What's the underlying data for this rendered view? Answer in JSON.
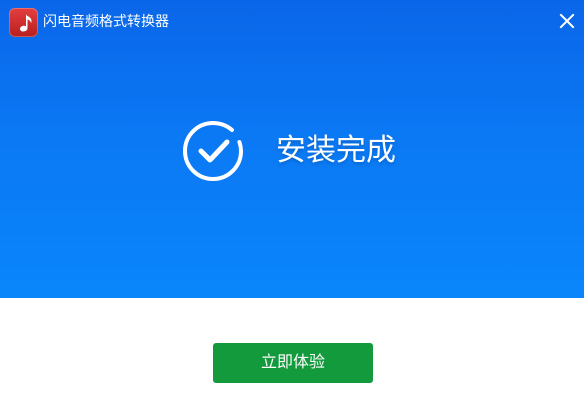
{
  "window": {
    "title": "闪电音频格式转换器",
    "app_icon": "music-note-icon",
    "close_icon": "close-icon"
  },
  "banner": {
    "status_icon": "check-circle-icon",
    "status_text": "安装完成"
  },
  "actions": {
    "primary_button": "立即体验"
  },
  "colors": {
    "banner": "#0a78f4",
    "button": "#139a3d",
    "logo": "#d33131",
    "background": "#ffffff"
  }
}
